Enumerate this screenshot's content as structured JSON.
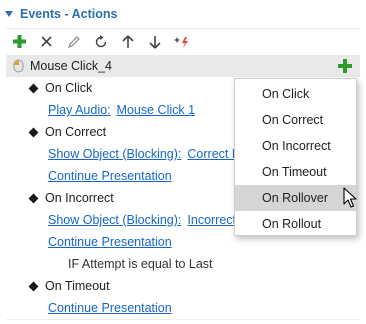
{
  "section": {
    "title": "Events - Actions"
  },
  "toolbar": {
    "buttons": [
      {
        "name": "add-icon",
        "color": "#2e9a2e"
      },
      {
        "name": "delete-icon"
      },
      {
        "name": "edit-pencil-icon"
      },
      {
        "name": "refresh-icon"
      },
      {
        "name": "move-up-icon"
      },
      {
        "name": "move-down-icon"
      },
      {
        "name": "clear-sparkle-icon"
      }
    ]
  },
  "trigger": {
    "label": "Mouse Click_4"
  },
  "rows": {
    "on_click": "On Click",
    "play_audio": "Play Audio:",
    "play_audio_target": "Mouse Click 1",
    "on_correct": "On Correct",
    "show_object_1": "Show Object (Blocking):",
    "show_object_1_target": "Correct M",
    "continue_1": "Continue Presentation",
    "on_incorrect": "On Incorrect",
    "show_object_2": "Show Object (Blocking):",
    "show_object_2_target": "Incorrect M",
    "continue_2": "Continue Presentation",
    "condition": "IF Attempt is equal to Last",
    "on_timeout": "On Timeout",
    "continue_3": "Continue Presentation"
  },
  "menu": {
    "items": [
      "On Click",
      "On Correct",
      "On Incorrect",
      "On Timeout",
      "On Rollover",
      "On Rollout"
    ],
    "highlighted": "On Rollover"
  },
  "colors": {
    "link": "#1667c7",
    "header": "#2a6fb0",
    "add": "#2e9a2e"
  }
}
